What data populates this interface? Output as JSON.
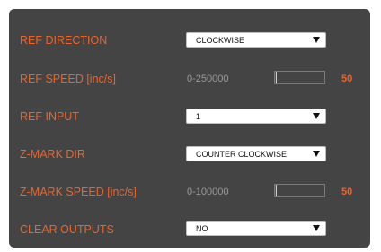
{
  "rows": [
    {
      "label": "REF DIRECTION",
      "control": "dropdown",
      "selected": "CLOCKWISE"
    },
    {
      "label": "REF SPEED [inc/s]",
      "control": "slider",
      "range": "0-250000",
      "value": "50",
      "level_fraction": 0.0002
    },
    {
      "label": "REF INPUT",
      "control": "dropdown",
      "selected": "1"
    },
    {
      "label": "Z-MARK DIR",
      "control": "dropdown",
      "selected": "COUNTER CLOCKWISE"
    },
    {
      "label": "Z-MARK SPEED [inc/s]",
      "control": "slider",
      "range": "0-100000",
      "value": "50",
      "level_fraction": 0.0005
    },
    {
      "label": "CLEAR OUTPUTS",
      "control": "dropdown",
      "selected": "NO"
    }
  ],
  "colors": {
    "panel_background": "#444444",
    "label_text": "#e8652d",
    "range_text": "#9a9a9a",
    "value_text": "#e8652d",
    "dropdown_background": "#ffffff"
  },
  "icons": {
    "dropdown_arrow": "triangle-down-icon"
  }
}
